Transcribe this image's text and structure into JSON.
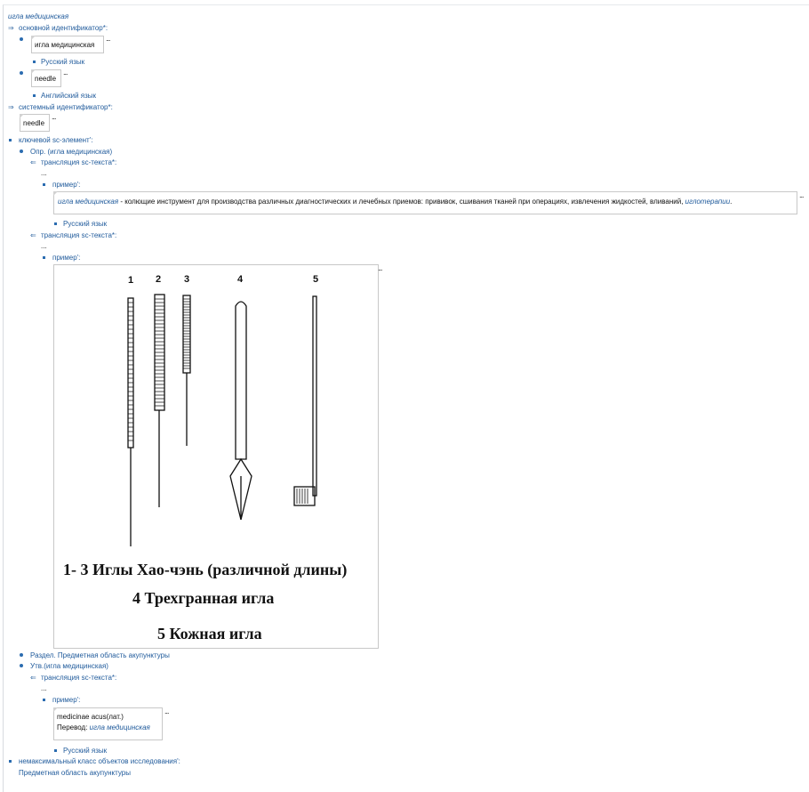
{
  "title": "игла медицинская",
  "main_id": {
    "label": "основной идентификатор*:",
    "items": [
      {
        "value": "игла медицинская",
        "lang": "Русский язык"
      },
      {
        "value": "needle",
        "lang": "Английский язык"
      }
    ]
  },
  "sys_id": {
    "label": "системный идентификатор*:",
    "value": "needle"
  },
  "key": {
    "label": "ключевой sc-элемент':",
    "def": {
      "label": "Опр. (игла медицинская)",
      "trans1": "трансляция sc-текста*:",
      "dots": "...",
      "example": "пример':",
      "text_term": "игла медицинская",
      "text_body": " - колющие инструмент для производства различных диагностических и лечебных приемов: прививок, сшивания тканей при операциях, извлечения жидкостей, вливаний, ",
      "text_link": "иглотерапии",
      "text_end": ".",
      "lang": "Русский язык",
      "trans2": "трансляция sc-текста*:",
      "example2": "пример':"
    },
    "image": {
      "labels": [
        "1",
        "2",
        "3",
        "4",
        "5"
      ],
      "caption1": "1- 3 Иглы Хао-чэнь (различной длины)",
      "caption2": "4 Трехгранная игла",
      "caption3": "5 Кожная игла"
    },
    "section": "Раздел. Предметная область акупунктуры",
    "stmt": {
      "label": "Утв.(игла медицинская)",
      "trans": "трансляция sc-текста*:",
      "dots": "...",
      "example": "пример':",
      "line1": "medicinae acus(лат.)",
      "line2_prefix": "Перевод: ",
      "line2_link": "игла медицинская",
      "lang": "Русский язык"
    }
  },
  "nonmax": {
    "label": "немаксимальный класс объектов исследования':",
    "value": "Предметная область акупунктуры"
  },
  "ellipsis": "..."
}
